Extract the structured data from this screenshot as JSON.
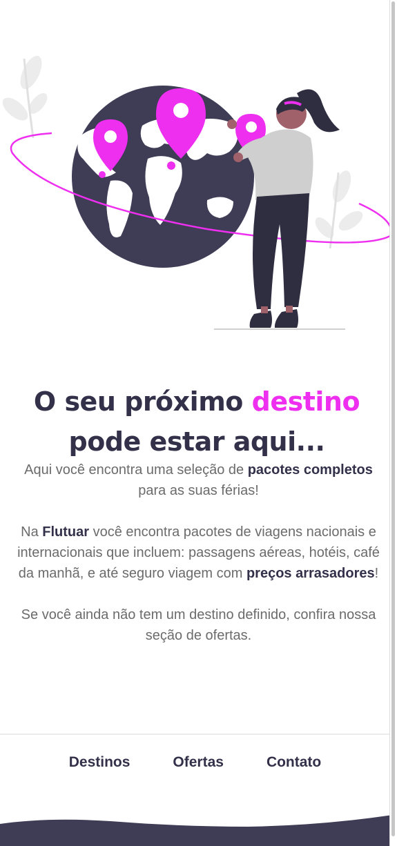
{
  "hero": {
    "illustration": "woman-with-globe-and-map-pins"
  },
  "headline": {
    "before": "O seu próximo ",
    "highlight": "destino",
    "after": " pode estar aqui..."
  },
  "intro": {
    "p1_text1": "Aqui você encontra uma seleção de ",
    "p1_bold": "pacotes completos",
    "p1_text2": " para as suas férias!",
    "p2_text1": "Na ",
    "p2_bold1": "Flutuar",
    "p2_text2": " você encontra pacotes de viagens nacionais e internacionais que incluem: passagens aéreas, hotéis, café da manhã, e até seguro viagem com ",
    "p2_bold2": "preços arrasadores",
    "p2_text3": "!",
    "p3_text": "Se você ainda não tem um destino definido, confira nossa seção de ofertas."
  },
  "nav": {
    "items": [
      "Destinos",
      "Ofertas",
      "Contato"
    ]
  },
  "colors": {
    "accent": "#ee2ff0",
    "dark": "#33304a",
    "text": "#6b6b6b"
  }
}
